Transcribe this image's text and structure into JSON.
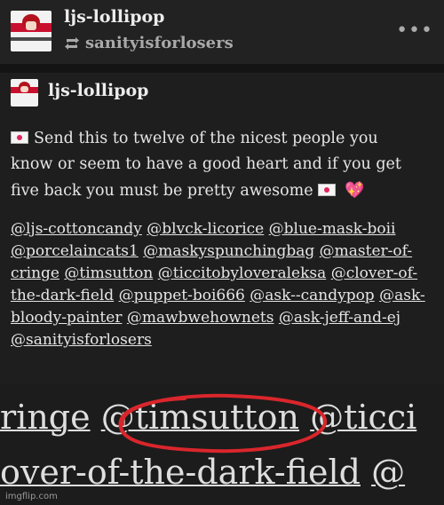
{
  "header": {
    "username": "ljs-lollipop",
    "reblogged_from": "sanityisforlosers",
    "more_icon": "ellipsis-icon",
    "reblog_icon": "reblog-icon"
  },
  "post": {
    "author": "ljs-lollipop",
    "message_line1": "Send this to twelve of the nicest people you",
    "message_line2": "know or seem to have a good heart and if you get",
    "message_line3": "five back you must be pretty awesome",
    "tags": [
      "@ljs-cottoncandy",
      "@blvck-licorice",
      "@blue-mask-boii",
      "@porcelaincats1",
      "@maskyspunchingbag",
      "@master-of-cringe",
      "@timsutton",
      "@ticcitobyloveraleksa",
      "@clover-of-the-dark-field",
      "@puppet-boi666",
      "@ask--candypop",
      "@ask-bloody-painter",
      "@mawbwehownets",
      "@ask-jeff-and-ej",
      "@sanityisforlosers"
    ]
  },
  "zoom": {
    "line1_a": "ringe",
    "line1_b": "@timsutton",
    "line1_c": "@ticci",
    "line2_a": "over-of-the-dark-field",
    "line2_b": "@"
  },
  "watermark": "imgflip.com",
  "colors": {
    "circle": "#d9262c",
    "background": "#1e1e1e"
  }
}
